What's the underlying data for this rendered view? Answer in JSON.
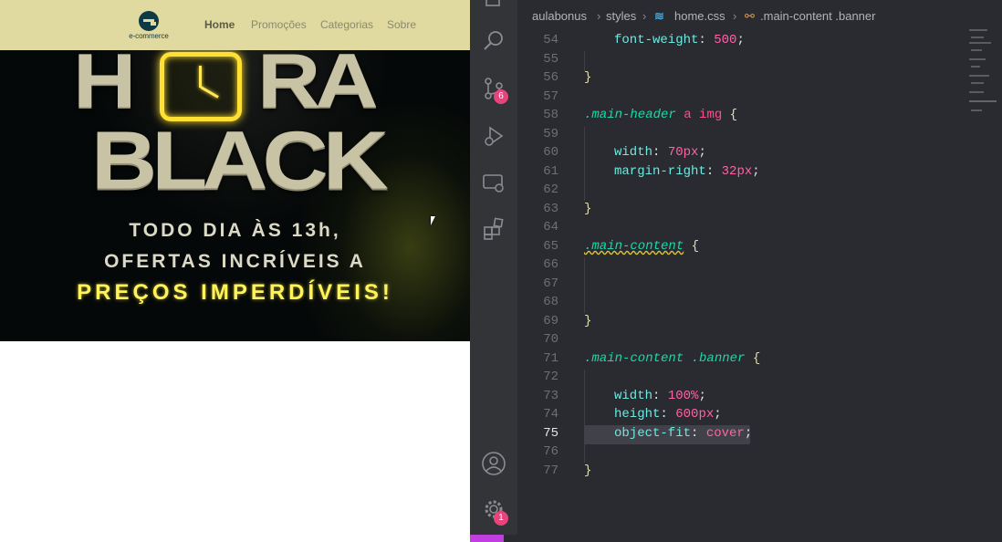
{
  "preview": {
    "logo_text": "e-commerce",
    "nav": [
      "Home",
      "Promoções",
      "Categorias",
      "Sobre"
    ],
    "banner": {
      "word1_left": "H",
      "word1_right": "RA",
      "word2": "BLACK",
      "line1": "TODO DIA ÀS 13h,",
      "line2": "OFERTAS INCRÍVEIS A",
      "line3": "PREÇOS IMPERDÍVEIS!"
    }
  },
  "editor": {
    "breadcrumbs": [
      "aulabonus",
      "styles",
      "home.css",
      ".main-content .banner"
    ],
    "activity_badges": {
      "source_control": "6",
      "settings": "1"
    },
    "current_line": 75,
    "lines": [
      {
        "n": "54"
      },
      {
        "n": "55"
      },
      {
        "n": "56"
      },
      {
        "n": "57"
      },
      {
        "n": "58"
      },
      {
        "n": "59"
      },
      {
        "n": "60"
      },
      {
        "n": "61"
      },
      {
        "n": "62"
      },
      {
        "n": "63"
      },
      {
        "n": "64"
      },
      {
        "n": "65"
      },
      {
        "n": "66"
      },
      {
        "n": "67"
      },
      {
        "n": "68"
      },
      {
        "n": "69"
      },
      {
        "n": "70"
      },
      {
        "n": "71"
      },
      {
        "n": "72"
      },
      {
        "n": "73"
      },
      {
        "n": "74"
      },
      {
        "n": "75"
      },
      {
        "n": "76"
      },
      {
        "n": "77"
      }
    ],
    "code": {
      "l54_prop": "font-weight",
      "l54_val": "500",
      "l56": "}",
      "l58_sel": ".main-header",
      "l58_tag1": "a",
      "l58_tag2": "img",
      "l58_brace": "{",
      "l60_prop": "width",
      "l60_val": "70px",
      "l61_prop": "margin-right",
      "l61_val": "32px",
      "l63": "}",
      "l65_sel": ".main-content",
      "l65_brace": "{",
      "l69": "}",
      "l71_sel1": ".main-content",
      "l71_sel2": ".banner",
      "l71_brace": "{",
      "l73_prop": "width",
      "l73_val": "100%",
      "l74_prop": "height",
      "l74_val": "600px",
      "l75_prop": "object-fit",
      "l75_val": "cover",
      "l77": "}"
    }
  },
  "colors": {
    "header_bg": "#e0d9a0",
    "editor_bg": "#2a2b30",
    "selector": "#18d9a8",
    "property": "#6ee8e0",
    "value": "#ff63a6",
    "badge": "#e8447c"
  }
}
